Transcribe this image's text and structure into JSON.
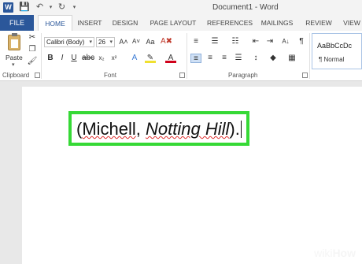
{
  "titlebar": {
    "title": "Document1 - Word"
  },
  "tabs": {
    "file": "FILE",
    "items": [
      "HOME",
      "INSERT",
      "DESIGN",
      "PAGE LAYOUT",
      "REFERENCES",
      "MAILINGS",
      "REVIEW",
      "VIEW"
    ],
    "active": "HOME"
  },
  "ribbon": {
    "clipboard": {
      "paste_label": "Paste",
      "group_label": "Clipboard"
    },
    "font": {
      "font_name": "Calibri (Body)",
      "font_size": "26",
      "group_label": "Font"
    },
    "paragraph": {
      "group_label": "Paragraph"
    },
    "styles": {
      "preview": "AaBbCcDc",
      "name": "¶ Normal"
    }
  },
  "document": {
    "text_open": "(",
    "text_author": "Michell",
    "text_comma": ", ",
    "text_title": "Notting Hill",
    "text_close": ")."
  },
  "watermark": {
    "brand_a": "wiki",
    "brand_b": "How"
  },
  "colors": {
    "accent": "#2b579a",
    "highlight": "#36d936",
    "spellcheck": "#e03030"
  }
}
